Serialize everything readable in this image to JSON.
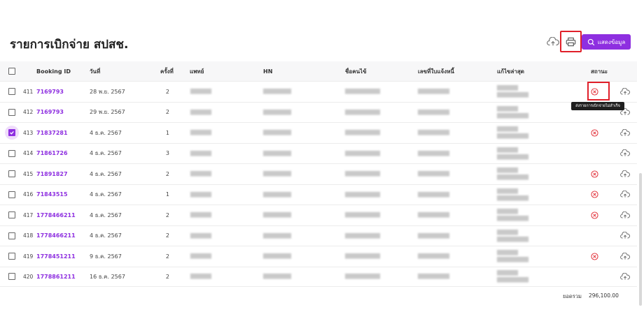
{
  "page": {
    "title": "รายการเบิกจ่าย สปสช.",
    "search_button_label": "แสดงข้อมูล"
  },
  "table": {
    "headers": {
      "booking_id": "Booking ID",
      "date": "วันที่",
      "times": "ครั้งที่",
      "doctor": "แพทย์",
      "hn": "HN",
      "user_name": "ชื่อคนไข้",
      "invoice_no": "เลขที่ใบแจ้งหนี้",
      "last_edited": "แก้ไขล่าสุด",
      "status": "สถานะ"
    },
    "rows": [
      {
        "no": "411",
        "booking_id": "7169793",
        "date": "28 พ.ย. 2567",
        "times": "2",
        "checked": false,
        "status_error": true
      },
      {
        "no": "412",
        "booking_id": "7169793",
        "date": "29 พ.ย. 2567",
        "times": "2",
        "checked": false,
        "status_error": false
      },
      {
        "no": "413",
        "booking_id": "71837281",
        "date": "4 ธ.ค. 2567",
        "times": "1",
        "checked": true,
        "status_error": true
      },
      {
        "no": "414",
        "booking_id": "71861726",
        "date": "4 ธ.ค. 2567",
        "times": "3",
        "checked": false,
        "status_error": false
      },
      {
        "no": "415",
        "booking_id": "71891827",
        "date": "4 ธ.ค. 2567",
        "times": "2",
        "checked": false,
        "status_error": true
      },
      {
        "no": "416",
        "booking_id": "71843515",
        "date": "4 ธ.ค. 2567",
        "times": "1",
        "checked": false,
        "status_error": true
      },
      {
        "no": "417",
        "booking_id": "1778466211",
        "date": "4 ธ.ค. 2567",
        "times": "2",
        "checked": false,
        "status_error": true
      },
      {
        "no": "418",
        "booking_id": "1778466211",
        "date": "4 ธ.ค. 2567",
        "times": "2",
        "checked": false,
        "status_error": false
      },
      {
        "no": "419",
        "booking_id": "1778451211",
        "date": "9 ธ.ค. 2567",
        "times": "2",
        "checked": false,
        "status_error": true
      },
      {
        "no": "420",
        "booking_id": "1778861211",
        "date": "16 ธ.ค. 2567",
        "times": "2",
        "checked": false,
        "status_error": false
      }
    ]
  },
  "tooltip": {
    "text": "ส่งรายการเบิกจ่ายไม่สำเร็จ"
  },
  "footer": {
    "total_label": "ยอดรวม",
    "total_value": "296,100.00"
  },
  "colors": {
    "accent": "#8e2fe0",
    "error": "#e0202a",
    "highlight_box": "#e0202a"
  },
  "icons": {
    "upload": "cloud-upload-icon",
    "print": "printer-icon",
    "search": "search-icon",
    "status_error": "x-circle-icon"
  }
}
